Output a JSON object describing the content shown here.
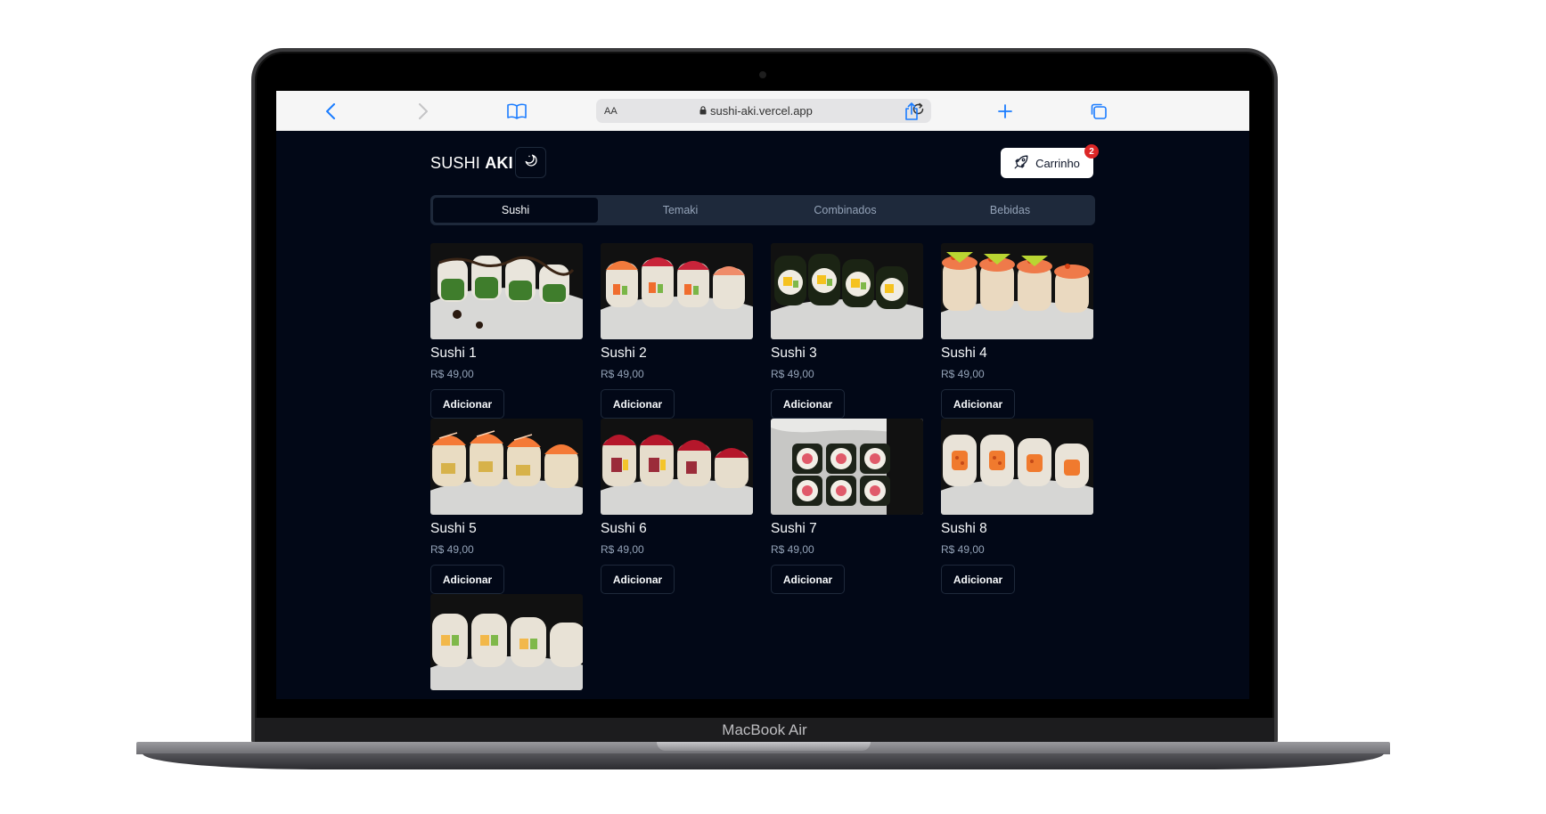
{
  "device": {
    "label": "MacBook Air"
  },
  "browser": {
    "text_size_label": "AA",
    "url": "sushi-aki.vercel.app"
  },
  "header": {
    "brand_prefix": "SUSHI",
    "brand_bold": "AKI",
    "cart_label": "Carrinho",
    "cart_count": "2"
  },
  "tabs": [
    {
      "label": "Sushi",
      "active": true
    },
    {
      "label": "Temaki",
      "active": false
    },
    {
      "label": "Combinados",
      "active": false
    },
    {
      "label": "Bebidas",
      "active": false
    }
  ],
  "products": [
    {
      "name": "Sushi 1",
      "price": "R$ 49,00",
      "button": "Adicionar"
    },
    {
      "name": "Sushi 2",
      "price": "R$ 49,00",
      "button": "Adicionar"
    },
    {
      "name": "Sushi 3",
      "price": "R$ 49,00",
      "button": "Adicionar"
    },
    {
      "name": "Sushi 4",
      "price": "R$ 49,00",
      "button": "Adicionar"
    },
    {
      "name": "Sushi 5",
      "price": "R$ 49,00",
      "button": "Adicionar"
    },
    {
      "name": "Sushi 6",
      "price": "R$ 49,00",
      "button": "Adicionar"
    },
    {
      "name": "Sushi 7",
      "price": "R$ 49,00",
      "button": "Adicionar"
    },
    {
      "name": "Sushi 8",
      "price": "R$ 49,00",
      "button": "Adicionar"
    },
    {
      "name": "",
      "price": "",
      "button": ""
    }
  ],
  "colors": {
    "page_bg": "#020817",
    "tab_bar_bg": "#1e293b",
    "badge": "#dc2626",
    "safari_accent": "#1a7cff"
  }
}
